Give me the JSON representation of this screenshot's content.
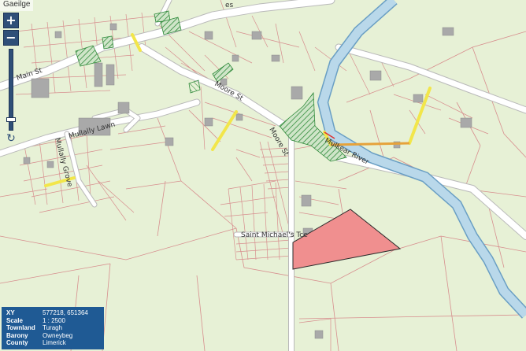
{
  "language_link": "Gaeilge",
  "controls": {
    "zoom_in_label": "+",
    "zoom_out_label": "−",
    "refresh_icon": "refresh-icon"
  },
  "labels": {
    "main_st": "Main St",
    "moore_st": "Moore St",
    "moore_st_2": "Moore St",
    "mulally_lawn": "Mullally Lawn",
    "mulally_grove": "Mullally Grove",
    "saint_michaels": "Saint Michael's Tce",
    "mulkear_river": "Mulkear River",
    "top_partial": "es"
  },
  "info": {
    "xy_label": "XY",
    "xy_value": "577218, 651364",
    "scale_label": "Scale",
    "scale_value": "1 : 2500",
    "townland_label": "Townland",
    "townland_value": "Turagh",
    "barony_label": "Barony",
    "barony_value": "Owneybeg",
    "county_label": "County",
    "county_value": "Limerick"
  },
  "colors": {
    "background": "#e7f1d6",
    "road": "#ffffff",
    "road_edge": "#b9b9b9",
    "parcel_line": "#d78e8e",
    "building": "#a9a9a9",
    "river": "#b9d8ea",
    "river_edge": "#6a9fc4",
    "highlight": "#f08f8f",
    "yellow": "#f2e64a",
    "hatch": "#2f8a3a",
    "info_bg": "#1f5a94"
  }
}
